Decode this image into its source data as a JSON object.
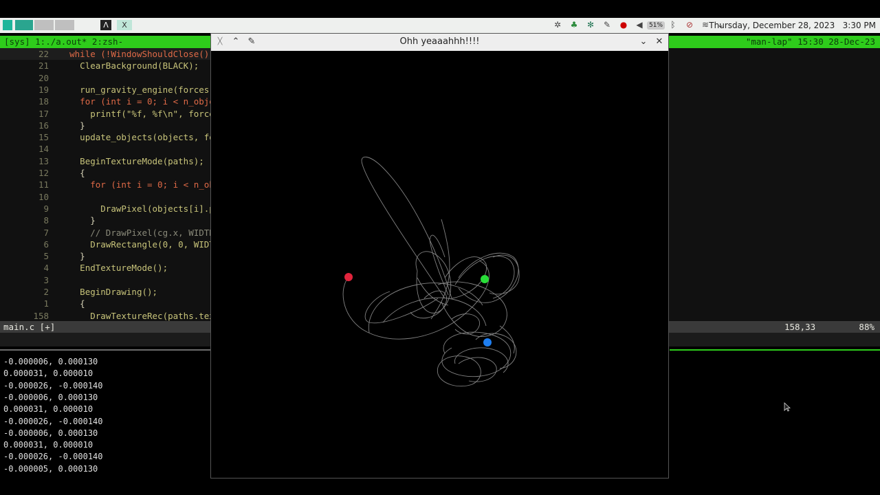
{
  "panel": {
    "clock": "Thursday, December 28, 2023   3:30 PM",
    "battery": "51%",
    "icons": [
      "app-menu-icon",
      "workspace-1",
      "workspace-2",
      "workspace-3",
      "workspace-4",
      "terminal-icon",
      "raylib-icon",
      "tray-icons"
    ]
  },
  "tmux": {
    "left": "[sys] 1:./a.out* 2:zsh-",
    "right": "\"man-lap\" 15:30 28-Dec-23"
  },
  "vim": {
    "lines": [
      {
        "n": "22",
        "t": "  while (!WindowShouldClose())"
      },
      {
        "n": "21",
        "t": "    ClearBackground(BLACK);"
      },
      {
        "n": "20",
        "t": ""
      },
      {
        "n": "19",
        "t": "    run_gravity_engine(forces,"
      },
      {
        "n": "18",
        "t": "    for (int i = 0; i < n_objec"
      },
      {
        "n": "17",
        "t": "      printf(\"%f, %f\\n\", forces"
      },
      {
        "n": "16",
        "t": "    }"
      },
      {
        "n": "15",
        "t": "    update_objects(objects, for"
      },
      {
        "n": "14",
        "t": ""
      },
      {
        "n": "13",
        "t": "    BeginTextureMode(paths);"
      },
      {
        "n": "12",
        "t": "    {"
      },
      {
        "n": "11",
        "t": "      for (int i = 0; i < n_obj"
      },
      {
        "n": "10",
        "t": ""
      },
      {
        "n": "9",
        "t": "        DrawPixel(objects[i].po"
      },
      {
        "n": "8",
        "t": "      }"
      },
      {
        "n": "7",
        "t": "      // DrawPixel(cg.x, WIDTH"
      },
      {
        "n": "6",
        "t": "      DrawRectangle(0, 0, WIDTH"
      },
      {
        "n": "5",
        "t": "    }"
      },
      {
        "n": "4",
        "t": "    EndTextureMode();"
      },
      {
        "n": "3",
        "t": ""
      },
      {
        "n": "2",
        "t": "    BeginDrawing();"
      },
      {
        "n": "1",
        "t": "    {"
      },
      {
        "n": "158",
        "t": "      DrawTextureRec(paths.text"
      }
    ],
    "status_file": "main.c [+]",
    "status_pos": "158,33",
    "status_pct": "88%"
  },
  "shell": {
    "output": [
      "-0.000006, 0.000130",
      "0.000031, 0.000010",
      "-0.000026, -0.000140",
      "-0.000006, 0.000130",
      "0.000031, 0.000010",
      "-0.000026, -0.000140",
      "-0.000006, 0.000130",
      "0.000031, 0.000010",
      "-0.000026, -0.000140",
      "-0.000005, 0.000130"
    ]
  },
  "window": {
    "title": "Ohh yeaaahhh!!!!",
    "bodies": [
      {
        "name": "red-body",
        "color": "#e0243c"
      },
      {
        "name": "green-body",
        "color": "#28dd38"
      },
      {
        "name": "blue-body",
        "color": "#1e7ef0"
      }
    ]
  }
}
